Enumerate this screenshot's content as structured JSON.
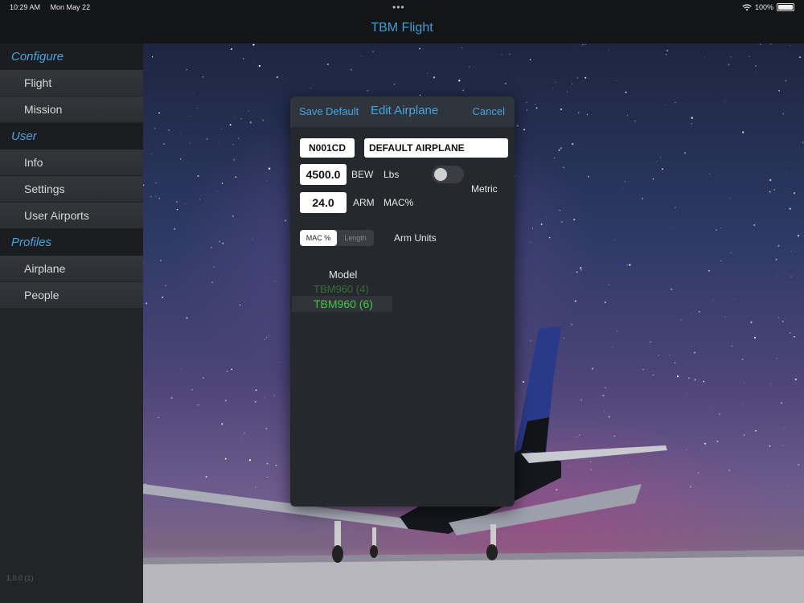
{
  "status_bar": {
    "time": "10:29 AM",
    "date": "Mon May 22",
    "battery": "100%"
  },
  "nav": {
    "title": "TBM Flight"
  },
  "sidebar": {
    "sections": [
      {
        "header": "Configure",
        "items": [
          "Flight",
          "Mission"
        ]
      },
      {
        "header": "User",
        "items": [
          "Info",
          "Settings",
          "User Airports"
        ]
      },
      {
        "header": "Profiles",
        "items": [
          "Airplane",
          "People"
        ]
      }
    ],
    "version": "1.0.0 (1)"
  },
  "modal": {
    "save_label": "Save",
    "default_label": "Default",
    "title": "Edit Airplane",
    "cancel_label": "Cancel",
    "tail_number": "N001CD",
    "airplane_name": "DEFAULT AIRPLANE",
    "bew_value": "4500.0",
    "bew_label": "BEW",
    "weight_unit": "Lbs",
    "arm_value": "24.0",
    "arm_label": "ARM",
    "arm_unit": "MAC%",
    "metric_label": "Metric",
    "metric_on": false,
    "arm_units_label": "Arm Units",
    "arm_units_options": [
      "MAC %",
      "Length"
    ],
    "arm_units_selected": "MAC %",
    "model_label": "Model",
    "model_options": [
      "TBM960 (4)",
      "TBM960 (6)"
    ],
    "model_selected": "TBM960 (6)"
  },
  "colors": {
    "accent": "#4aa3e0",
    "picker_green": "#42c842"
  }
}
